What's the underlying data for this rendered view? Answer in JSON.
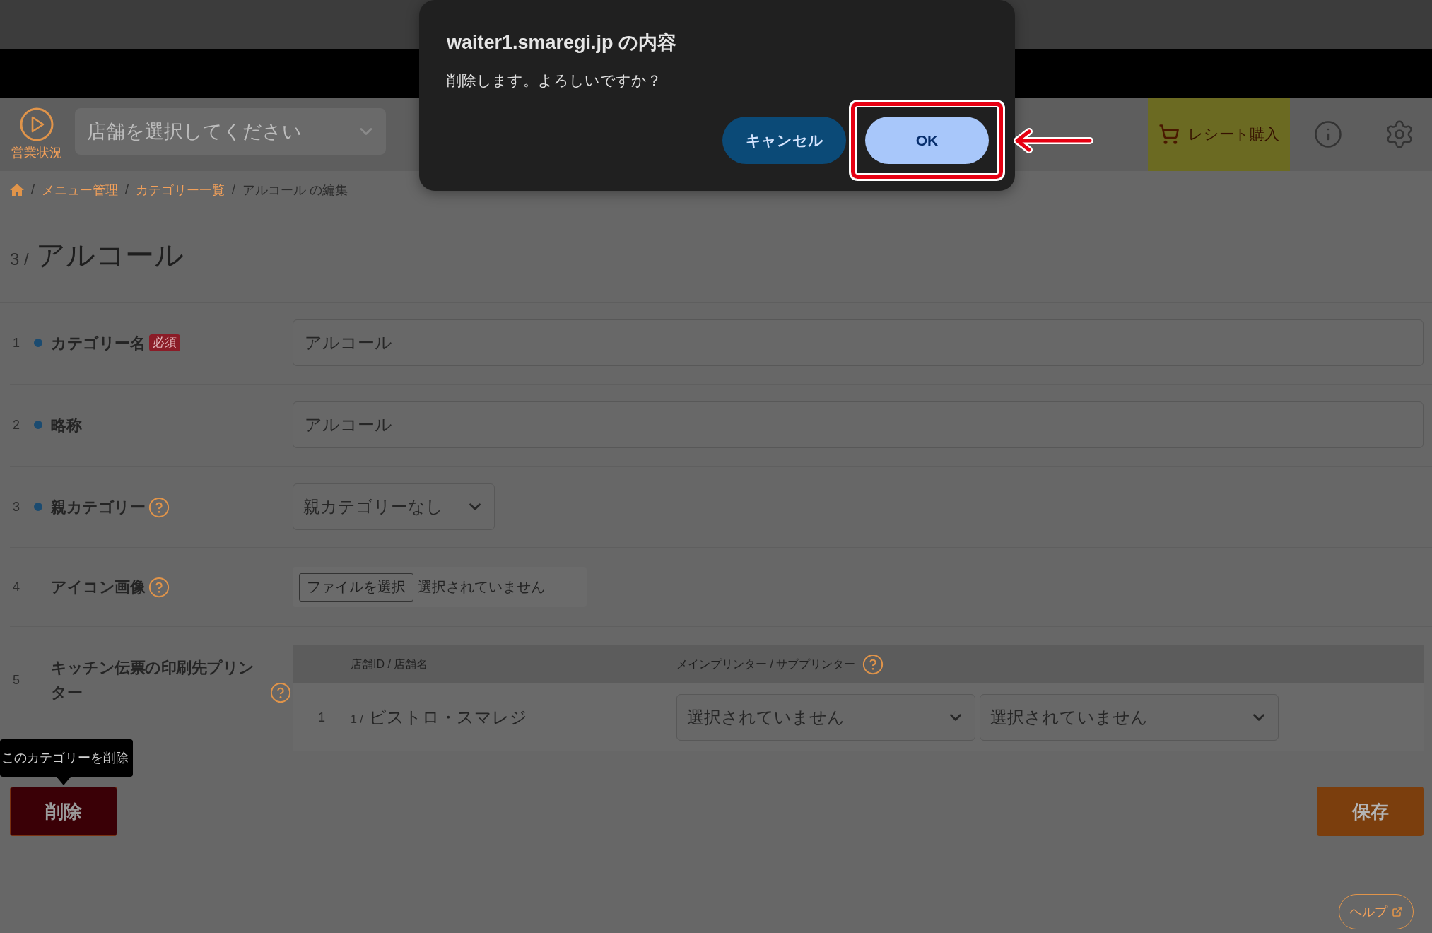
{
  "dialog": {
    "title": "waiter1.smaregi.jp の内容",
    "message": "削除します。よろしいですか？",
    "buttons": [
      {
        "label": "キャンセル",
        "kind": "secondary",
        "highlighted": false
      },
      {
        "label": "OK",
        "kind": "primary",
        "highlighted": true
      }
    ]
  },
  "header": {
    "status_link": "営業状況",
    "store_select": {
      "placeholder": "店舗を選択してください"
    },
    "receipt_button": "レシート購入"
  },
  "breadcrumb": {
    "separator": "/",
    "items": [
      {
        "label": "メニュー管理",
        "kind": "link"
      },
      {
        "label": "カテゴリー一覧",
        "kind": "link"
      },
      {
        "label": "アルコール の編集",
        "kind": "current"
      }
    ]
  },
  "title": {
    "number": "3 /",
    "name": "アルコール"
  },
  "fields": [
    {
      "number": "1",
      "label": "カテゴリー名",
      "marked": true,
      "badge": "必須",
      "help": false,
      "kind": "text",
      "value": "アルコール"
    },
    {
      "number": "2",
      "label": "略称",
      "marked": true,
      "help": false,
      "kind": "text",
      "value": "アルコール"
    },
    {
      "number": "3",
      "label": "親カテゴリー",
      "marked": true,
      "help": true,
      "kind": "select",
      "value": "親カテゴリーなし"
    },
    {
      "number": "4",
      "label": "アイコン画像",
      "marked": false,
      "help": true,
      "kind": "file",
      "button": "ファイルを選択",
      "status": "選択されていません"
    },
    {
      "number": "5",
      "label": "キッチン伝票の印刷先プリンター",
      "marked": false,
      "help": true,
      "kind": "table",
      "table": {
        "columns": [
          {
            "label": "店舗ID / 店舗名",
            "help": false
          },
          {
            "label": "メインプリンター / サブプリンター",
            "help": true
          }
        ],
        "rows": [
          {
            "number": "1",
            "store_id": "1 /",
            "store_name": "ビストロ・スマレジ",
            "printers": [
              "選択されていません",
              "選択されていません"
            ]
          }
        ]
      }
    }
  ],
  "tooltip": "このカテゴリーを削除",
  "actions": {
    "delete": "削除",
    "save": "保存"
  },
  "help_link": "ヘルプ"
}
